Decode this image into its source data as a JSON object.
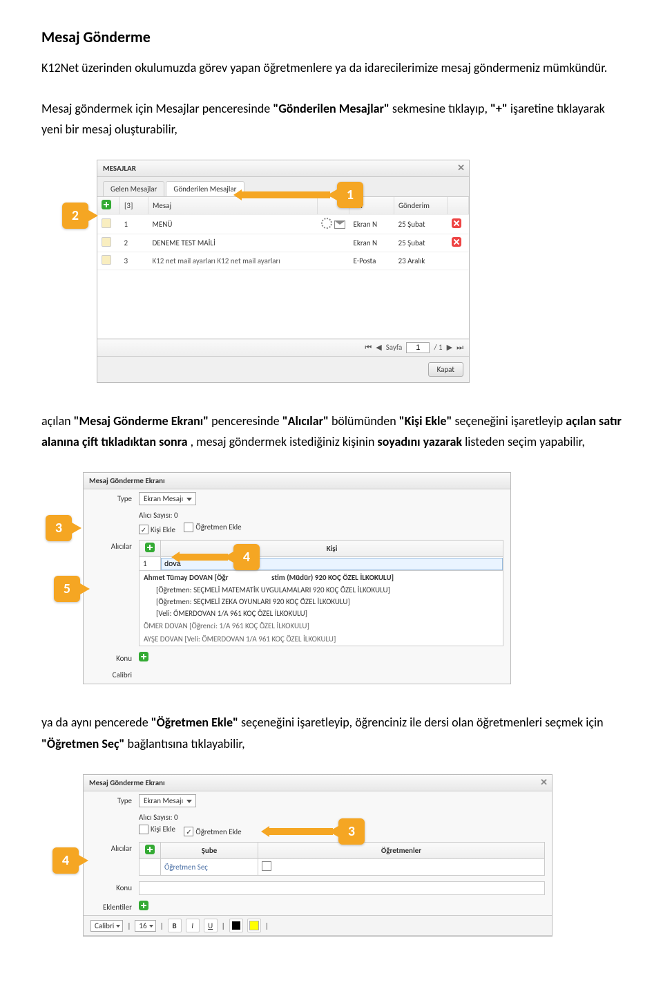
{
  "heading": "Mesaj Gönderme",
  "para1": {
    "t1": "K12Net üzerinden okulumuzda görev yapan öğretmenlere ya da idarecilerimize mesaj göndermeniz mümkündür."
  },
  "para2": {
    "t1": "Mesaj göndermek için Mesajlar penceresinde ",
    "b1": "\"Gönderilen Mesajlar\"",
    "t2": " sekmesine tıklayıp, ",
    "b2": "\"+\"",
    "t3": " işaretine tıklayarak yeni bir mesaj oluşturabilir,"
  },
  "fig1": {
    "callouts": {
      "one": "1",
      "two": "2"
    },
    "window_title": "MESAJLAR",
    "tabs": {
      "inbox": "Gelen Mesajlar",
      "sent": "Gönderilen Mesajlar"
    },
    "headers": {
      "count": "[3]",
      "subject": "Mesaj",
      "type": "Tür",
      "sent": "Gönderim"
    },
    "rows": [
      {
        "n": "1",
        "subj": "MENÜ",
        "type": "Ekran N",
        "date": "25 Şubat",
        "has_del": true,
        "icons": "gearenv"
      },
      {
        "n": "2",
        "subj": "DENEME TEST MAİLİ",
        "type": "Ekran N",
        "date": "25 Şubat",
        "has_del": true,
        "icons": ""
      },
      {
        "n": "3",
        "subj": "K12 net mail ayarları K12 net mail ayarları",
        "type": "E-Posta",
        "date": "23 Aralık",
        "has_del": false,
        "icons": ""
      }
    ],
    "pager": {
      "label": "Sayfa",
      "page": "1",
      "total": "/ 1"
    },
    "close_btn": "Kapat"
  },
  "para3": {
    "t1": "açılan ",
    "b1": "\"Mesaj Gönderme Ekranı\"",
    "t2": " penceresinde ",
    "b2": "\"Alıcılar\"",
    "t3": " bölümünden ",
    "b3": "\"Kişi Ekle\"",
    "t4": " seçeneğini işaretleyip ",
    "b4": "açılan satır alanına çift tıkladıktan sonra",
    "t5": ", mesaj göndermek istediğiniz kişinin ",
    "b5": "soyadını yazarak",
    "t6": " listeden seçim yapabilir,"
  },
  "fig2": {
    "callouts": {
      "three": "3",
      "four": "4",
      "five": "5"
    },
    "title": "Mesaj Gönderme Ekranı",
    "labels": {
      "type": "Type",
      "recipients": "Alıcılar",
      "subject": "Konu",
      "font": "Calibri"
    },
    "type_value": "Ekran Mesajı",
    "count": "Alıcı Sayısı: 0",
    "kisi_ekle": "Kişi Ekle",
    "ogretmen_ekle": "Öğretmen Ekle",
    "th_kisi": "Kişi",
    "row_n": "1",
    "input_value": "dova",
    "suggest1": "Ahmet Tümay DOVAN [Öğr",
    "suggest1a": "stim (Müdür) 920 KOÇ ÖZEL İLKOKULU]",
    "suggest1b": "[Öğretmen: SEÇMELİ MATEMATİK UYGULAMALARI 920 KOÇ ÖZEL İLKOKULU]",
    "suggest1c": "[Öğretmen: SEÇMELİ ZEKA OYUNLARI 920 KOÇ ÖZEL İLKOKULU]",
    "suggest1d": "[Veli: ÖMERDOVAN 1/A 961 KOÇ ÖZEL İLKOKULU]",
    "suggest2": "ÖMER DOVAN [Öğrenci: 1/A 961 KOÇ ÖZEL İLKOKULU]",
    "suggest3": "AYŞE DOVAN [Veli: ÖMERDOVAN 1/A 961 KOÇ ÖZEL İLKOKULU]"
  },
  "para4": {
    "t1": "ya da aynı pencerede ",
    "b1": "\"Öğretmen Ekle\"",
    "t2": " seçeneğini işaretleyip, öğrenciniz ile dersi olan öğretmenleri seçmek için ",
    "b2": "\"Öğretmen Seç\"",
    "t3": " bağlantısına tıklayabilir,"
  },
  "fig3": {
    "callouts": {
      "three": "3",
      "four": "4"
    },
    "title": "Mesaj Gönderme Ekranı",
    "labels": {
      "type": "Type",
      "recipients": "Alıcılar",
      "subject": "Konu",
      "attach": "Eklentiler"
    },
    "type_value": "Ekran Mesajı",
    "count": "Alıcı Sayısı: 0",
    "kisi_ekle": "Kişi Ekle",
    "ogretmen_ekle": "Öğretmen Ekle",
    "th_sube": "Şube",
    "th_ogr": "Öğretmenler",
    "link": "Öğretmen Seç",
    "toolbar": {
      "font": "Calibri",
      "size": "16",
      "b": "B",
      "i": "I",
      "u": "U"
    }
  }
}
